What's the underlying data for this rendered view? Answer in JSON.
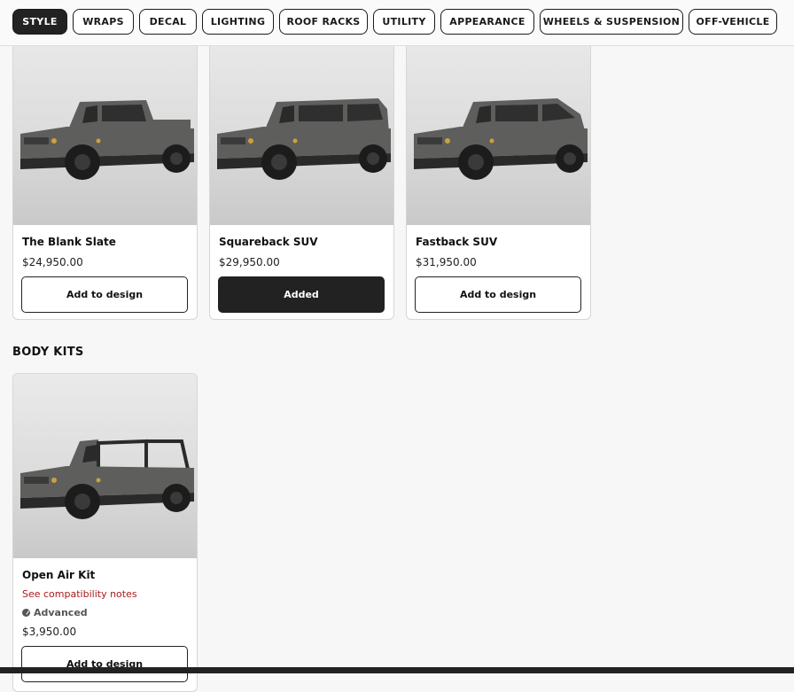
{
  "tabs": [
    {
      "label": "STYLE",
      "active": true
    },
    {
      "label": "WRAPS"
    },
    {
      "label": "DECAL"
    },
    {
      "label": "LIGHTING"
    },
    {
      "label": "ROOF RACKS"
    },
    {
      "label": "UTILITY"
    },
    {
      "label": "APPEARANCE"
    },
    {
      "label": "WHEELS & SUSPENSION"
    },
    {
      "label": "OFF-VEHICLE"
    }
  ],
  "styles": [
    {
      "name": "The Blank Slate",
      "price": "$24,950.00",
      "button": "Add to design",
      "added": false,
      "body": "pickup"
    },
    {
      "name": "Squareback SUV",
      "price": "$29,950.00",
      "button": "Added",
      "added": true,
      "body": "square"
    },
    {
      "name": "Fastback SUV",
      "price": "$31,950.00",
      "button": "Add to design",
      "added": false,
      "body": "fast"
    }
  ],
  "body_kits": {
    "title": "BODY KITS",
    "items": [
      {
        "name": "Open Air Kit",
        "note": "See compatibility notes",
        "level": "Advanced",
        "level_icon": "gauge-icon",
        "price": "$3,950.00",
        "button": "Add to design",
        "body": "open"
      }
    ]
  },
  "colors": {
    "accent": "#222222",
    "note": "#a81a1a",
    "vehicle": "#5e5e5c"
  }
}
